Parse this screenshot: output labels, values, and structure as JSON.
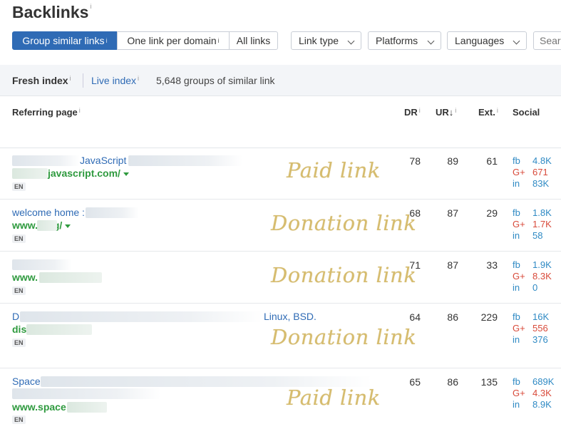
{
  "title": "Backlinks",
  "info_mark": "i",
  "toolbar": {
    "group_similar": "Group similar links",
    "one_per_domain": "One link per domain",
    "all_links": "All links",
    "link_type": "Link type",
    "platforms": "Platforms",
    "languages": "Languages",
    "search_placeholder": "Search"
  },
  "index": {
    "fresh": "Fresh index",
    "live": "Live index",
    "count": "5,648 groups of similar link"
  },
  "columns": {
    "referring_page": "Referring page",
    "dr": "DR",
    "ur": "UR",
    "ur_sort": "↓",
    "ext": "Ext.",
    "social": "Social"
  },
  "social_labels": {
    "fb": "fb",
    "gplus": "G+",
    "in": "in"
  },
  "rows": [
    {
      "title": "JavaScript",
      "url": "javascript.com/",
      "lang": "EN",
      "dr": "78",
      "ur": "89",
      "ext": "61",
      "fb": "4.8K",
      "gplus": "671",
      "in": "83K",
      "stamp": "Paid link"
    },
    {
      "title": "welcome home :",
      "url": "www.        .org/",
      "lang": "EN",
      "dr": "68",
      "ur": "87",
      "ext": "29",
      "fb": "1.8K",
      "gplus": "1.7K",
      "in": "58",
      "stamp": "Donation link"
    },
    {
      "title": "",
      "url": "www.                       .net/",
      "lang": "EN",
      "dr": "71",
      "ur": "87",
      "ext": "33",
      "fb": "1.9K",
      "gplus": "8.3K",
      "in": "0",
      "stamp": "Donation link"
    },
    {
      "title": "D",
      "title_end": "Linux, BSD.",
      "url": "dis                         /",
      "lang": "EN",
      "dr": "64",
      "ur": "86",
      "ext": "229",
      "fb": "16K",
      "gplus": "556",
      "in": "376",
      "stamp": "Donation link"
    },
    {
      "title": "Space",
      "url": "www.space                com/",
      "lang": "EN",
      "dr": "65",
      "ur": "86",
      "ext": "135",
      "fb": "689K",
      "gplus": "4.3K",
      "in": "8.9K",
      "stamp": "Paid link"
    }
  ]
}
